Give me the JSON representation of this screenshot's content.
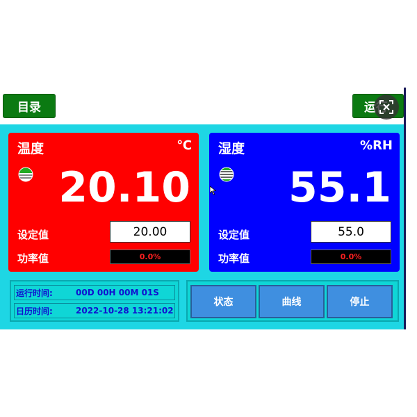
{
  "header": {
    "menu_label": "目录",
    "run_label": "运行"
  },
  "fullscreen": {
    "icon": "fullscreen-exit-icon"
  },
  "temperature": {
    "title": "温度",
    "unit": "℃",
    "value": "20.10",
    "set_label": "设定值",
    "set_value": "20.00",
    "power_label": "功率值",
    "power_value": "0.0%",
    "indicator_icon": "status-indicator-icon"
  },
  "humidity": {
    "title": "湿度",
    "unit": "%RH",
    "value": "55.1",
    "set_label": "设定值",
    "set_value": "55.0",
    "power_label": "功率值",
    "power_value": "0.0%",
    "indicator_icon": "status-indicator-icon"
  },
  "time": {
    "run_label": "运行时间:",
    "run_value": "00D 00H 00M 01S",
    "date_label": "日历时间:",
    "date_value": "2022-10-28 13:21:02"
  },
  "actions": {
    "status_label": "状态",
    "curve_label": "曲线",
    "stop_label": "停止"
  },
  "colors": {
    "temp_panel": "#ff0000",
    "hum_panel": "#0000ff",
    "background": "#1ed6e4",
    "green_button": "#0b7a12",
    "action_button": "#3f8fe0"
  }
}
